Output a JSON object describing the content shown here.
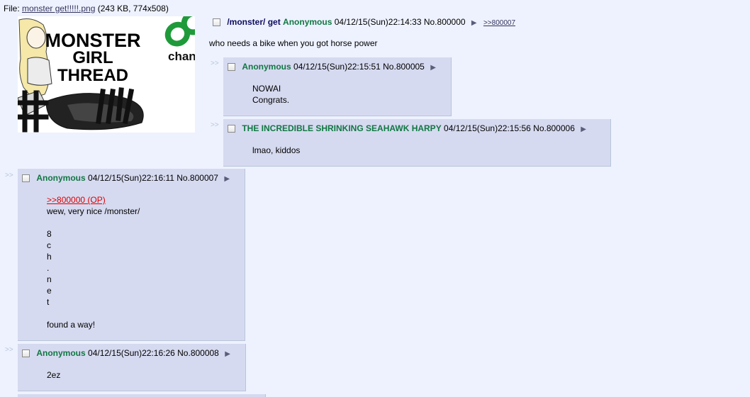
{
  "file": {
    "prefix": "File:",
    "filename": "monster get!!!!!.png",
    "meta": "(243 KB, 774x508)"
  },
  "thumbnail": {
    "line1": "MONSTER",
    "line2": "GIRL",
    "line3": "THREAD",
    "logo_text": "chan"
  },
  "op": {
    "subject": "/monster/ get",
    "name": "Anonymous",
    "datetime": "04/12/15(Sun)22:14:33",
    "number": "No.800000",
    "backlink": ">>800007",
    "message": "who needs a bike when you got horse power"
  },
  "side_arrows": ">>",
  "replies": [
    {
      "name": "Anonymous",
      "datetime": "04/12/15(Sun)22:15:51",
      "number": "No.800005",
      "lines": [
        "NOWAI",
        "Congrats."
      ]
    },
    {
      "name": "THE INCREDIBLE SHRINKING SEAHAWK HARPY",
      "datetime": "04/12/15(Sun)22:15:56",
      "number": "No.800006",
      "lines": [
        "lmao, kiddos"
      ]
    },
    {
      "name": "Anonymous",
      "datetime": "04/12/15(Sun)22:16:11",
      "number": "No.800007",
      "quote": ">>800000 (OP)",
      "lines": [
        "wew, very nice /monster/",
        "",
        "8",
        "c",
        "h",
        ".",
        "n",
        "e",
        "t",
        "",
        "found a way!"
      ]
    },
    {
      "name": "Anonymous",
      "datetime": "04/12/15(Sun)22:16:26",
      "number": "No.800008",
      "lines": [
        "2ez"
      ]
    }
  ]
}
